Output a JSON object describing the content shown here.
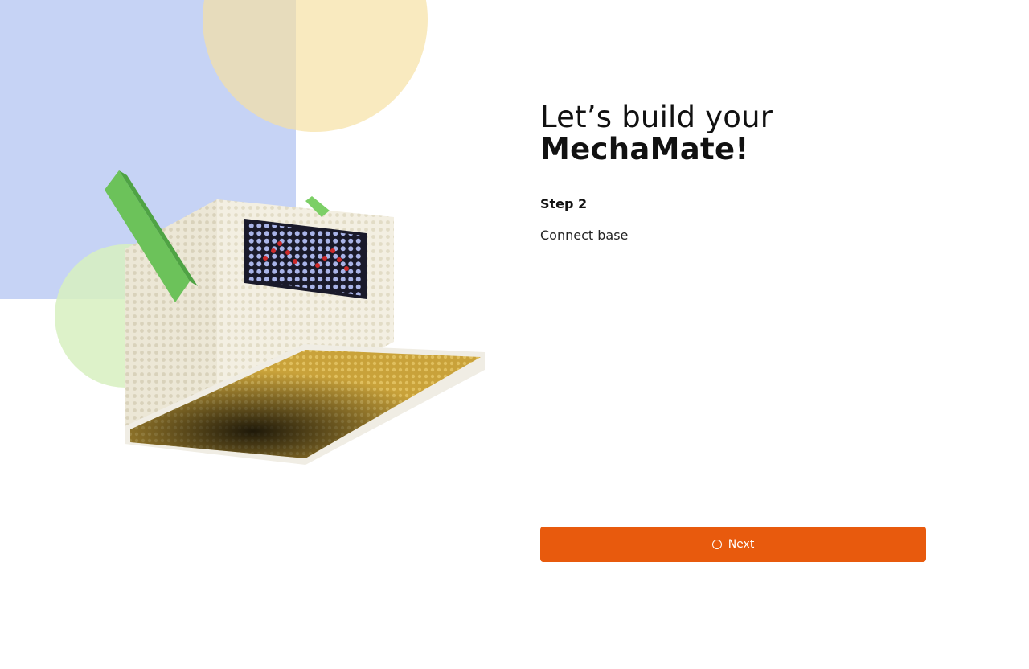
{
  "heading": {
    "line1": "Let’s build your",
    "line2": "MechaMate!"
  },
  "step": {
    "label": "Step 2",
    "description": "Connect base"
  },
  "actions": {
    "next_label": "Next",
    "next_icon": "spinner-icon"
  },
  "colors": {
    "accent": "#e85a0d",
    "shape_blue": "#c6d3f5",
    "shape_yellow": "#f6e0a1",
    "shape_green": "#d7f0c0"
  }
}
